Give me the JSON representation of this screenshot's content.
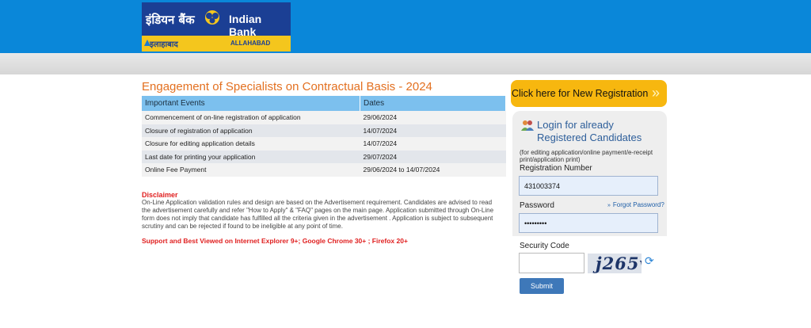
{
  "brand": {
    "hindi_name": "इंडियन बैंक",
    "english_name": "Indian Bank",
    "sub_hindi": "इलाहाबाद",
    "sub_english": "ALLAHABAD"
  },
  "main": {
    "title": "Engagement of Specialists on Contractual Basis - 2024",
    "table": {
      "headers": [
        "Important Events",
        "Dates"
      ],
      "rows": [
        [
          "Commencement of on-line registration of application",
          "29/06/2024"
        ],
        [
          "Closure of registration of application",
          "14/07/2024"
        ],
        [
          "Closure for editing application details",
          "14/07/2024"
        ],
        [
          "Last date for printing your application",
          "29/07/2024"
        ],
        [
          "Online Fee Payment",
          "29/06/2024 to 14/07/2024"
        ]
      ]
    },
    "disclaimer_title": "Disclaimer",
    "disclaimer_text": "On-Line Application validation rules and design are based on the Advertisement requirement. Candidates are advised to read the advertisement carefully and refer \"How to Apply\" & \"FAQ\" pages on the main page. Application submitted through On-Line form does not imply that candidate has fulfilled all the criteria given in the advertisement . Application is subject to subsequent scrutiny and can be rejected if found to be ineligible at any point of time.",
    "support_text": "Support and Best Viewed on Internet Explorer 9+; Google Chrome 30+ ; Firefox 20+"
  },
  "sidebar": {
    "new_registration_label": "Click here for New Registration",
    "login_title": "Login for already Registered Candidates",
    "login_note": "(for editing application/online payment/e-receipt print/application print)",
    "registration_number_label": "Registration Number",
    "registration_number_value": "431003374",
    "password_label": "Password",
    "password_value": "123456789",
    "forgot_password_label": "Forgot Password?",
    "security_code_label": "Security Code",
    "security_code_value": "",
    "captcha_text": "j265v",
    "submit_label": "Submit"
  },
  "colors": {
    "header_blue": "#0a87d9",
    "title_orange": "#e37020",
    "new_reg_yellow": "#f7b70f",
    "disclaimer_red": "#e02020",
    "login_title_blue": "#2d5e9a"
  },
  "icons": [
    "indian-bank-emblem-icon",
    "users-login-icon",
    "double-chevron-right-icon",
    "refresh-captcha-icon"
  ]
}
